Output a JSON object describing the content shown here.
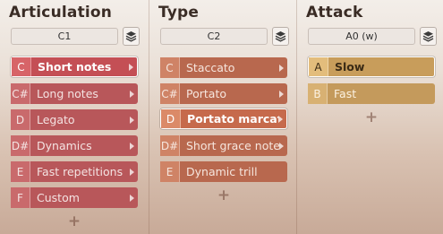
{
  "columns": {
    "articulation": {
      "title": "Articulation",
      "selector": "C1",
      "items": [
        {
          "key": "C",
          "label": "Short notes"
        },
        {
          "key": "C#",
          "label": "Long notes"
        },
        {
          "key": "D",
          "label": "Legato"
        },
        {
          "key": "D#",
          "label": "Dynamics"
        },
        {
          "key": "E",
          "label": "Fast repetitions"
        },
        {
          "key": "F",
          "label": "Custom"
        }
      ],
      "add_label": "+"
    },
    "type": {
      "title": "Type",
      "selector": "C2",
      "items": [
        {
          "key": "C",
          "label": "Staccato"
        },
        {
          "key": "C#",
          "label": "Portato"
        },
        {
          "key": "D",
          "label": "Portato marcato"
        },
        {
          "key": "D#",
          "label": "Short grace note"
        },
        {
          "key": "E",
          "label": "Dynamic trill"
        }
      ],
      "add_label": "+"
    },
    "attack": {
      "title": "Attack",
      "selector": "A0 (w)",
      "items": [
        {
          "key": "A",
          "label": "Slow"
        },
        {
          "key": "B",
          "label": "Fast"
        }
      ],
      "add_label": "+"
    }
  },
  "icons": {
    "stack": "layers-icon",
    "submenu": "chevron-right-icon"
  }
}
